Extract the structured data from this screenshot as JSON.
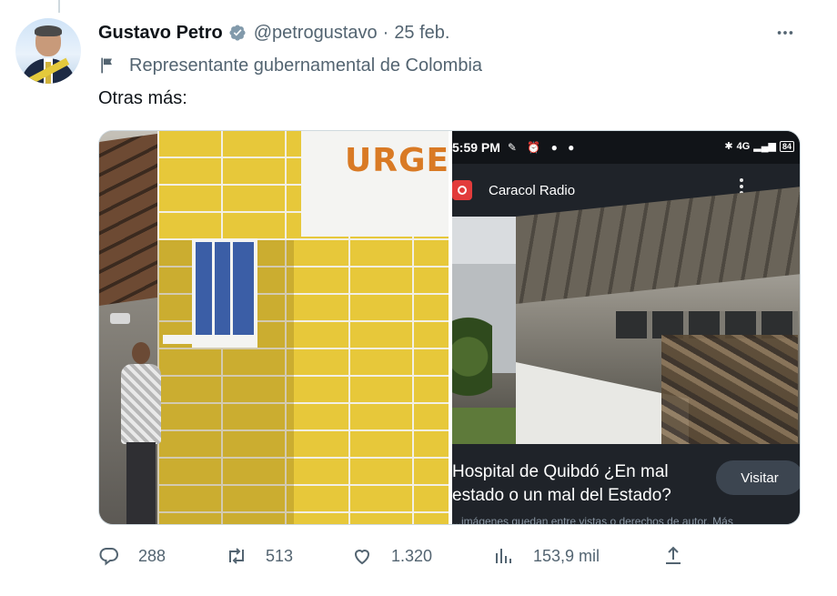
{
  "tweet": {
    "author_name": "Gustavo Petro",
    "handle": "@petrogustavo",
    "separator": "·",
    "date": "25 feb.",
    "label": "Representante gubernamental de Colombia",
    "text": "Otras más:",
    "more_icon": "more-horizontal-icon"
  },
  "media": {
    "left_sign_text": "URGEN",
    "right": {
      "status_time": "5:59 PM",
      "battery": "84",
      "status_right_text": "4G",
      "app_name": "Caracol Radio",
      "card_title": "Hospital de Quibdó ¿En mal estado o un mal del Estado?",
      "visit_label": "Visitar",
      "snippet": "...imágenes quedan entre vistas o derechos de autor. Más"
    }
  },
  "actions": {
    "replies": "288",
    "retweets": "513",
    "likes": "1.320",
    "views": "153,9 mil"
  },
  "colors": {
    "accent": "#1d9bf0",
    "secondary_text": "#536471",
    "primary_text": "#0f1419"
  }
}
